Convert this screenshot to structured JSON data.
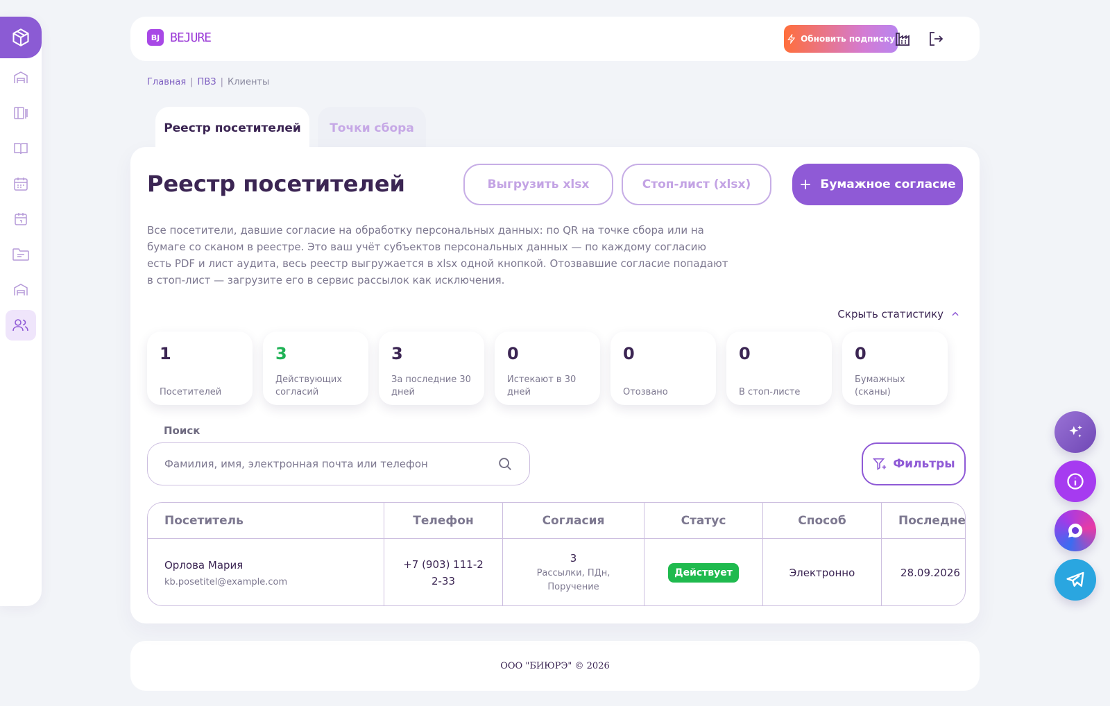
{
  "header": {
    "logo_mark": "BJ",
    "logo_text": "BEJURE",
    "upgrade_label": "Обновить подписку"
  },
  "breadcrumb": [
    "Главная",
    "ПВЗ",
    "Клиенты"
  ],
  "tabs": [
    {
      "label": "Реестр посетителей",
      "active": true
    },
    {
      "label": "Точки сбора",
      "active": false
    }
  ],
  "page": {
    "title": "Реестр посетителей",
    "export_label": "Выгрузить xlsx",
    "stoplist_label": "Стоп-лист (xlsx)",
    "paper_consent_label": "Бумажное согласие",
    "description": "Все посетители, давшие согласие на обработку персональных данных: по QR на точке сбора или на бумаге со сканом в реестре. Это ваш учёт субъектов персональных данных — по каждому согласию есть PDF и лист аудита, весь реестр выгружается в xlsx одной кнопкой. Отозвавшие согласие попадают в стоп-лист — загрузите его в сервис рассылок как исключения.",
    "hide_stats_label": "Скрыть статистику"
  },
  "stats": [
    {
      "value": "1",
      "label": "Посетителей"
    },
    {
      "value": "3",
      "label": "Действующих согласий"
    },
    {
      "value": "3",
      "label": "За последние 30 дней"
    },
    {
      "value": "0",
      "label": "Истекают в 30 дней"
    },
    {
      "value": "0",
      "label": "Отозвано"
    },
    {
      "value": "0",
      "label": "В стоп-листе"
    },
    {
      "value": "0",
      "label": "Бумажных (сканы)"
    }
  ],
  "search": {
    "label": "Поиск",
    "placeholder": "Фамилия, имя, электронная почта или телефон",
    "value": ""
  },
  "filters_label": "Фильтры",
  "table": {
    "columns": [
      "Посетитель",
      "Телефон",
      "Согласия",
      "Статус",
      "Способ",
      "Последнее"
    ],
    "rows": [
      {
        "name": "Орлова Мария",
        "email": "kb.posetitel@example.com",
        "phone": "+7 (903) 111-22-33",
        "consents_count": "3",
        "consents_types": "Рассылки, ПДн, Поручение",
        "status": "Действует",
        "method": "Электронно",
        "last": "28.09.2026"
      }
    ]
  },
  "footer": "ООО \"БИЮРЭ\" © 2026",
  "colors": {
    "accent": "#8f5ad6",
    "brand": "#a848e6",
    "status_active": "#1fba4e",
    "stat_green": "#1fb255",
    "text_dark": "#3b2553"
  }
}
